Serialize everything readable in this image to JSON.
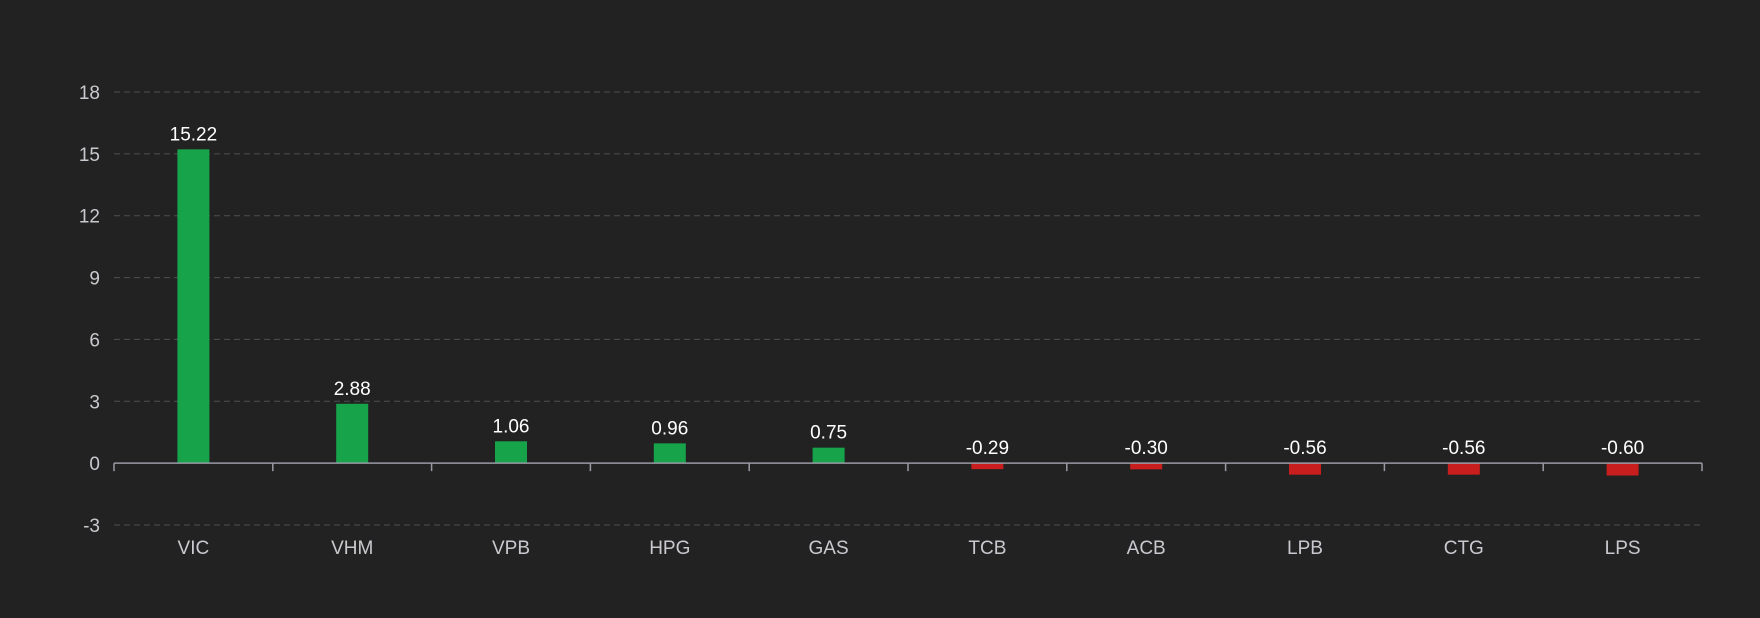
{
  "chart_data": {
    "type": "bar",
    "title": "",
    "xlabel": "",
    "ylabel": "",
    "categories": [
      "VIC",
      "VHM",
      "VPB",
      "HPG",
      "GAS",
      "TCB",
      "ACB",
      "LPB",
      "CTG",
      "LPS"
    ],
    "values": [
      15.22,
      2.88,
      1.06,
      0.96,
      0.75,
      -0.29,
      -0.3,
      -0.56,
      -0.56,
      -0.6
    ],
    "value_labels": [
      "15.22",
      "2.88",
      "1.06",
      "0.96",
      "0.75",
      "-0.29",
      "-0.30",
      "-0.56",
      "-0.56",
      "-0.60"
    ],
    "ylim": [
      -3,
      18
    ],
    "yticks": [
      -3,
      0,
      3,
      6,
      9,
      12,
      15,
      18
    ],
    "grid": true,
    "legend": "none",
    "colors": {
      "positive": "#16a34a",
      "negative": "#c81e1e",
      "background": "#222222",
      "grid": "#4f4f4f",
      "axis": "#9a9aa6",
      "tick_text": "#c9c9cf",
      "label_text": "#ffffff"
    }
  }
}
